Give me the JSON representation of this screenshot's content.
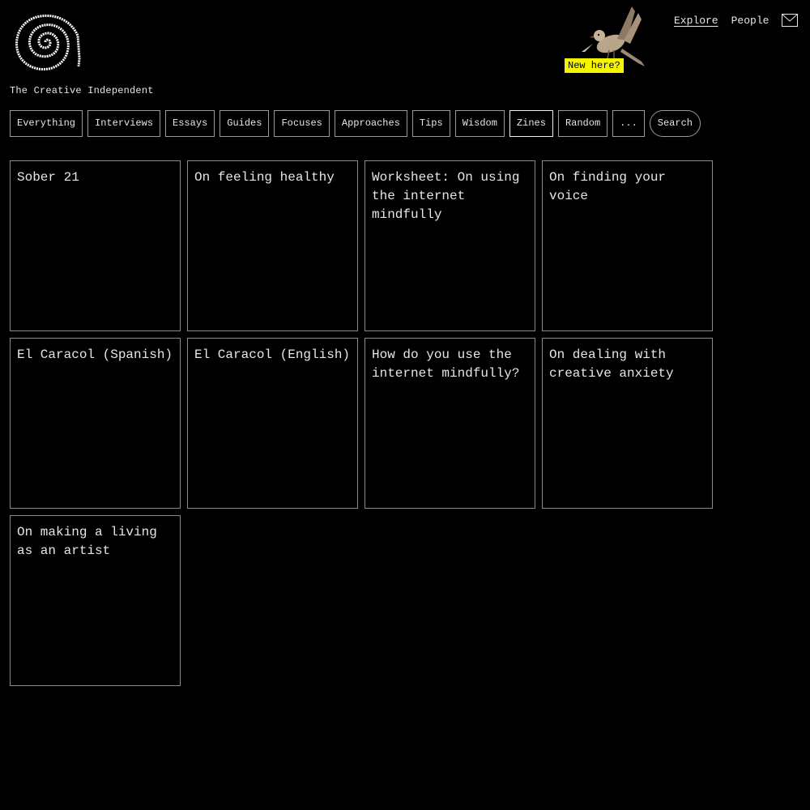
{
  "site": {
    "name": "The Creative Independent",
    "logo_icon": "spiral-icon",
    "new_badge": "New here?"
  },
  "topnav": {
    "explore": "Explore",
    "people": "People",
    "mail_icon": "mail-icon"
  },
  "filters": [
    {
      "label": "Everything",
      "active": false
    },
    {
      "label": "Interviews",
      "active": false
    },
    {
      "label": "Essays",
      "active": false
    },
    {
      "label": "Guides",
      "active": false
    },
    {
      "label": "Focuses",
      "active": false
    },
    {
      "label": "Approaches",
      "active": false
    },
    {
      "label": "Tips",
      "active": false
    },
    {
      "label": "Wisdom",
      "active": false
    },
    {
      "label": "Zines",
      "active": true
    },
    {
      "label": "Random",
      "active": false
    },
    {
      "label": "...",
      "active": false
    },
    {
      "label": "Search",
      "active": false
    }
  ],
  "cards": [
    {
      "title": "Sober 21"
    },
    {
      "title": "On feeling healthy"
    },
    {
      "title": "Worksheet: On using the internet mindfully"
    },
    {
      "title": "On finding your voice"
    },
    {
      "title": "El Caracol (Spanish)"
    },
    {
      "title": "El Caracol (English)"
    },
    {
      "title": "How do you use the internet mindfully?"
    },
    {
      "title": "On dealing with creative anxiety"
    },
    {
      "title": "On making a living as an artist"
    }
  ],
  "colors": {
    "background": "#000000",
    "text": "#e6e6e6",
    "badge": "#f5f500"
  }
}
